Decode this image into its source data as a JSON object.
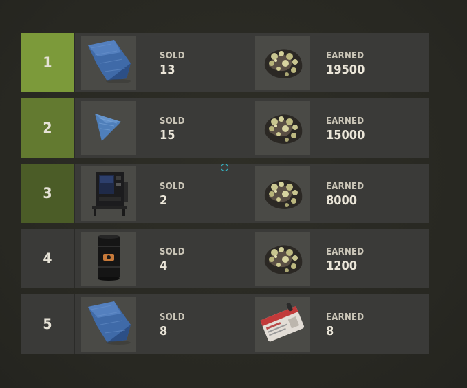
{
  "leaderboard": {
    "rows": [
      {
        "rank": "1",
        "item_icon": "tarp-icon",
        "sold_label": "SOLD",
        "sold": "13",
        "reward_icon": "metal-ore-icon",
        "earned_label": "EARNED",
        "earned": "19500"
      },
      {
        "rank": "2",
        "item_icon": "cloth-scrap-icon",
        "sold_label": "SOLD",
        "sold": "15",
        "reward_icon": "metal-ore-icon",
        "earned_label": "EARNED",
        "earned": "15000"
      },
      {
        "rank": "3",
        "item_icon": "vending-machine-icon",
        "sold_label": "SOLD",
        "sold": "2",
        "reward_icon": "metal-ore-icon",
        "earned_label": "EARNED",
        "earned": "8000"
      },
      {
        "rank": "4",
        "item_icon": "oil-barrel-icon",
        "sold_label": "SOLD",
        "sold": "4",
        "reward_icon": "metal-ore-icon",
        "earned_label": "EARNED",
        "earned": "1200"
      },
      {
        "rank": "5",
        "item_icon": "tarp-icon",
        "sold_label": "SOLD",
        "sold": "8",
        "reward_icon": "keycard-icon",
        "earned_label": "EARNED",
        "earned": "8"
      }
    ]
  },
  "colors": {
    "rank1": "#7c9a3a",
    "rank2": "#637a30",
    "rank3": "#4b5c27",
    "row_bg": "#3a3a38",
    "slot_bg": "#4a4a46",
    "cursor": "#35b5c4"
  }
}
